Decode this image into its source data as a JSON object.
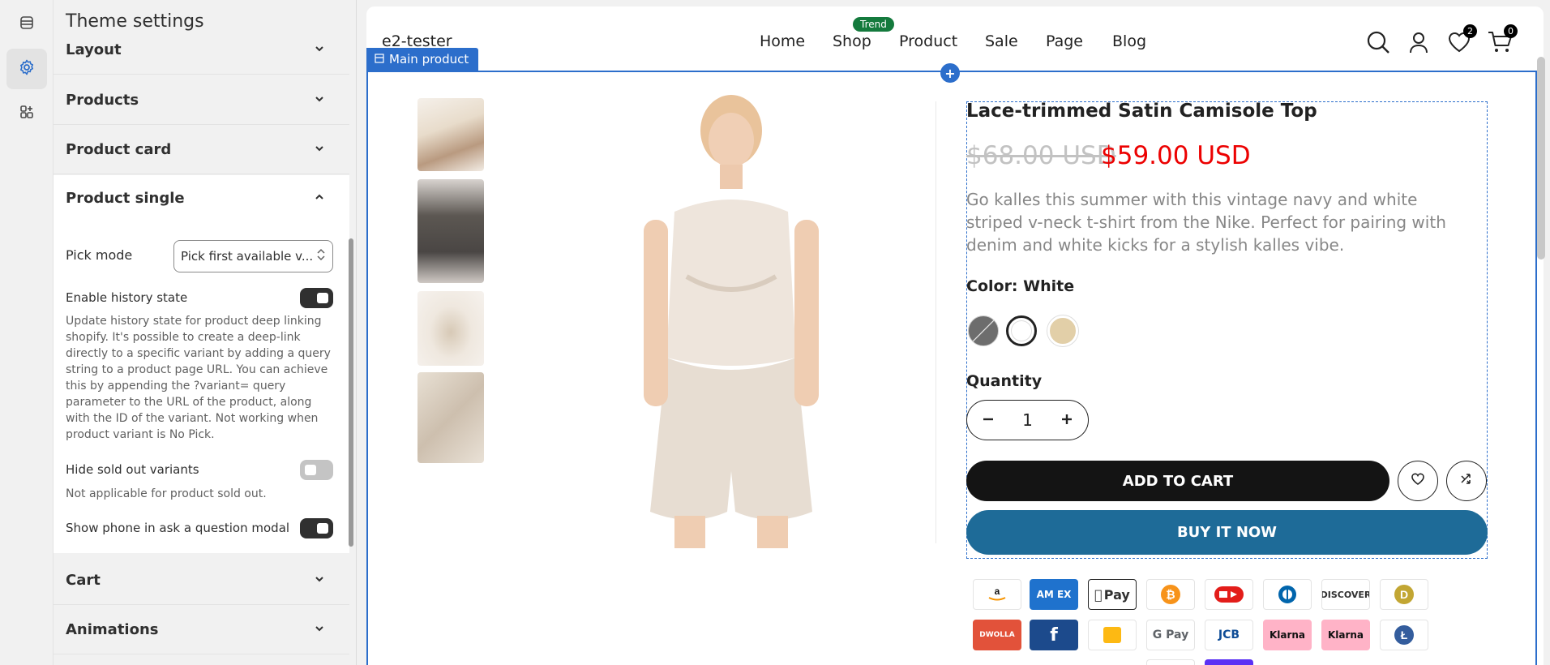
{
  "panel": {
    "title": "Theme settings",
    "sections": [
      "Layout",
      "Products",
      "Product card"
    ],
    "expanded": {
      "title": "Product single",
      "pick_mode_label": "Pick mode",
      "pick_mode_value": "Pick first available v...",
      "history_label": "Enable history state",
      "history_help": "Update history state for product deep linking shopify. It's possible to create a deep-link directly to a specific variant by adding a query string to a product page URL. You can achieve this by appending the ?variant= query parameter to the URL of the product, along with the ID of the variant. Not working when product variant is No Pick.",
      "hide_sold_label": "Hide sold out variants",
      "hide_sold_help": "Not applicable for product sold out.",
      "phone_label": "Show phone in ask a question modal"
    },
    "bottom_sections": [
      "Cart",
      "Animations"
    ]
  },
  "preview": {
    "store_name": "e2-tester",
    "nav": [
      "Home",
      "Shop",
      "Product",
      "Sale",
      "Page",
      "Blog"
    ],
    "trend_badge": "Trend",
    "wishlist_count": "2",
    "cart_count": "0",
    "section_tag": "Main product",
    "product": {
      "title": "Lace-trimmed Satin Camisole Top",
      "price_old": "$68.00 USD",
      "price_new": "$59.00 USD",
      "description": "Go kalles this summer with this vintage navy and white striped v-neck t-shirt from the Nike. Perfect for pairing with denim and white kicks for a stylish kalles vibe.",
      "color_label": "Color: White",
      "swatches": [
        "#6d6d6d",
        "#ffffff",
        "#e2cfa8"
      ],
      "quantity_label": "Quantity",
      "quantity": "1",
      "add_to_cart": "ADD TO CART",
      "buy_now": "BUY IT NOW"
    },
    "payments_row1": [
      "amazon",
      "amex",
      "apple-pay",
      "bitcoin",
      "dankort",
      "diners",
      "discover",
      "dogecoin"
    ],
    "payments_row2": [
      "dwolla",
      "forbrugsforeningen",
      "interac",
      "google-pay",
      "jcb",
      "klarna",
      "klarna",
      "litecoin"
    ],
    "payment_labels": {
      "amex": "AM EX",
      "apple": "Pay",
      "discover": "DISCOVER",
      "dwolla": "DWOLLA",
      "gpay": "G Pay",
      "jcb": "JCB",
      "klarna": "Klarna"
    }
  }
}
